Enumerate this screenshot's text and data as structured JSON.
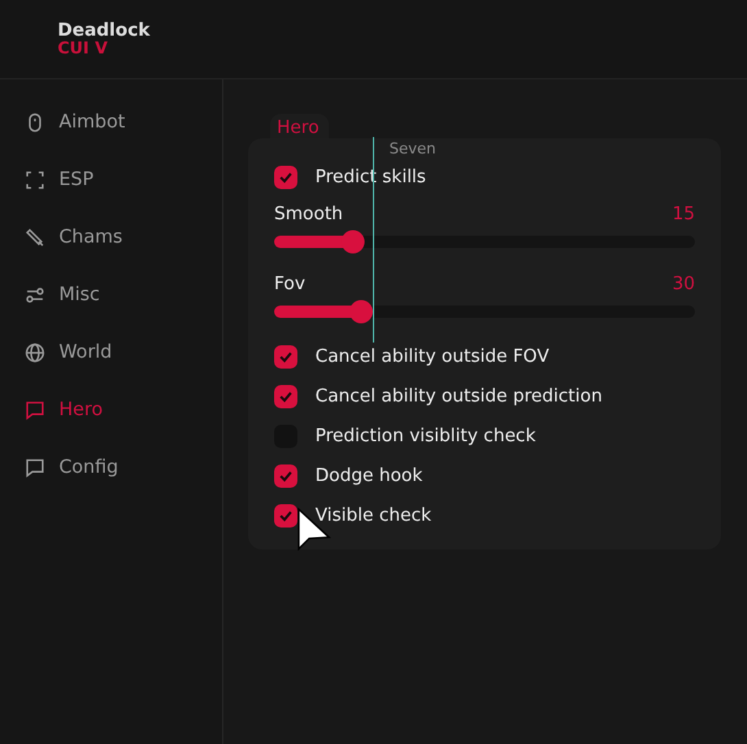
{
  "logo": {
    "title": "Deadlock",
    "subtitle": "CUI V"
  },
  "sidebar": {
    "items": [
      {
        "label": "Aimbot",
        "selected": false
      },
      {
        "label": "ESP",
        "selected": false
      },
      {
        "label": "Chams",
        "selected": false
      },
      {
        "label": "Misc",
        "selected": false
      },
      {
        "label": "World",
        "selected": false
      },
      {
        "label": "Hero",
        "selected": true
      },
      {
        "label": "Config",
        "selected": false
      }
    ]
  },
  "panel": {
    "tab": "Hero",
    "tooltip": "Seven",
    "items": [
      {
        "kind": "checkbox",
        "label": "Predict skills",
        "checked": true
      },
      {
        "kind": "slider",
        "label": "Smooth",
        "reading": "15",
        "level": 0.19
      },
      {
        "kind": "slider",
        "label": "Fov",
        "reading": "30",
        "level": 0.21
      },
      {
        "kind": "checkbox",
        "label": "Cancel ability outside FOV",
        "checked": true
      },
      {
        "kind": "checkbox",
        "label": "Cancel ability outside prediction",
        "checked": true
      },
      {
        "kind": "checkbox",
        "label": "Prediction visiblity check",
        "checked": false
      },
      {
        "kind": "checkbox",
        "label": "Dodge hook",
        "checked": true
      },
      {
        "kind": "checkbox",
        "label": "Visible check",
        "checked": true
      }
    ]
  }
}
